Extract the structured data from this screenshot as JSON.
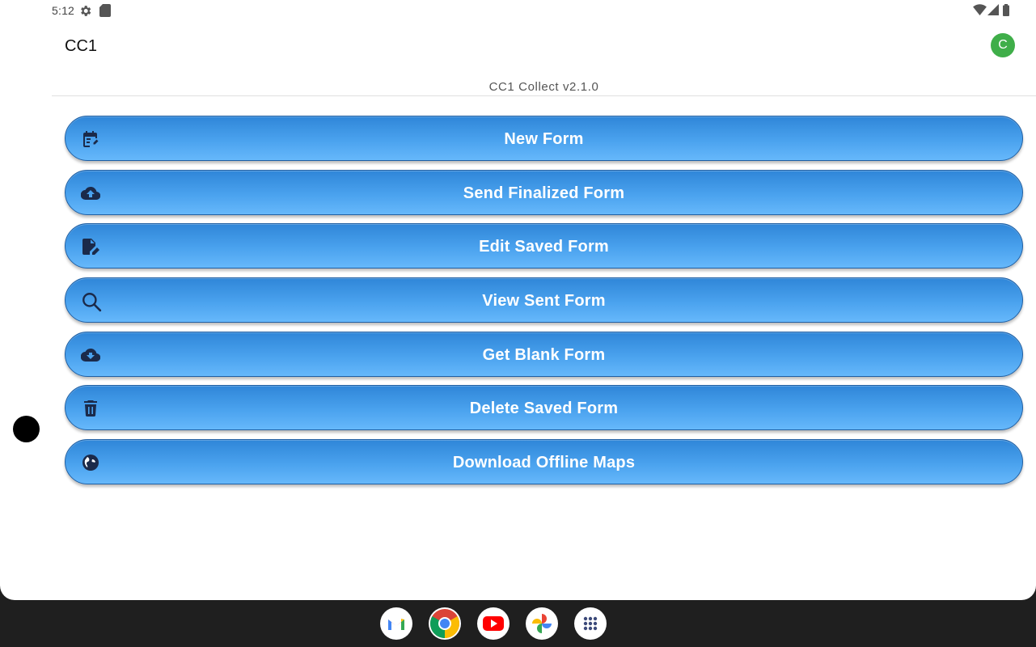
{
  "status_bar": {
    "time": "5:12",
    "icons": [
      "settings-gear-icon",
      "sd-card-icon",
      "wifi-icon",
      "cell-signal-icon",
      "battery-icon"
    ]
  },
  "app_bar": {
    "title": "CC1",
    "avatar_letter": "C",
    "avatar_color": "#3fae49"
  },
  "version_text": "CC1 Collect v2.1.0",
  "menu": {
    "buttons": [
      {
        "label": "New Form",
        "icon": "calendar-edit-icon"
      },
      {
        "label": "Send Finalized Form",
        "icon": "cloud-upload-icon"
      },
      {
        "label": "Edit Saved Form",
        "icon": "file-edit-icon"
      },
      {
        "label": "View Sent Form",
        "icon": "search-icon"
      },
      {
        "label": "Get Blank Form",
        "icon": "cloud-download-icon"
      },
      {
        "label": "Delete Saved Form",
        "icon": "trash-icon"
      },
      {
        "label": "Download Offline Maps",
        "icon": "globe-icon"
      }
    ],
    "button_color_top": "#2f86d8",
    "button_color_bottom": "#66b8fb",
    "icon_color": "#1b2a4a"
  },
  "taskbar": {
    "apps": [
      "gmail-icon",
      "chrome-icon",
      "youtube-icon",
      "photos-icon",
      "app-drawer-icon"
    ]
  }
}
